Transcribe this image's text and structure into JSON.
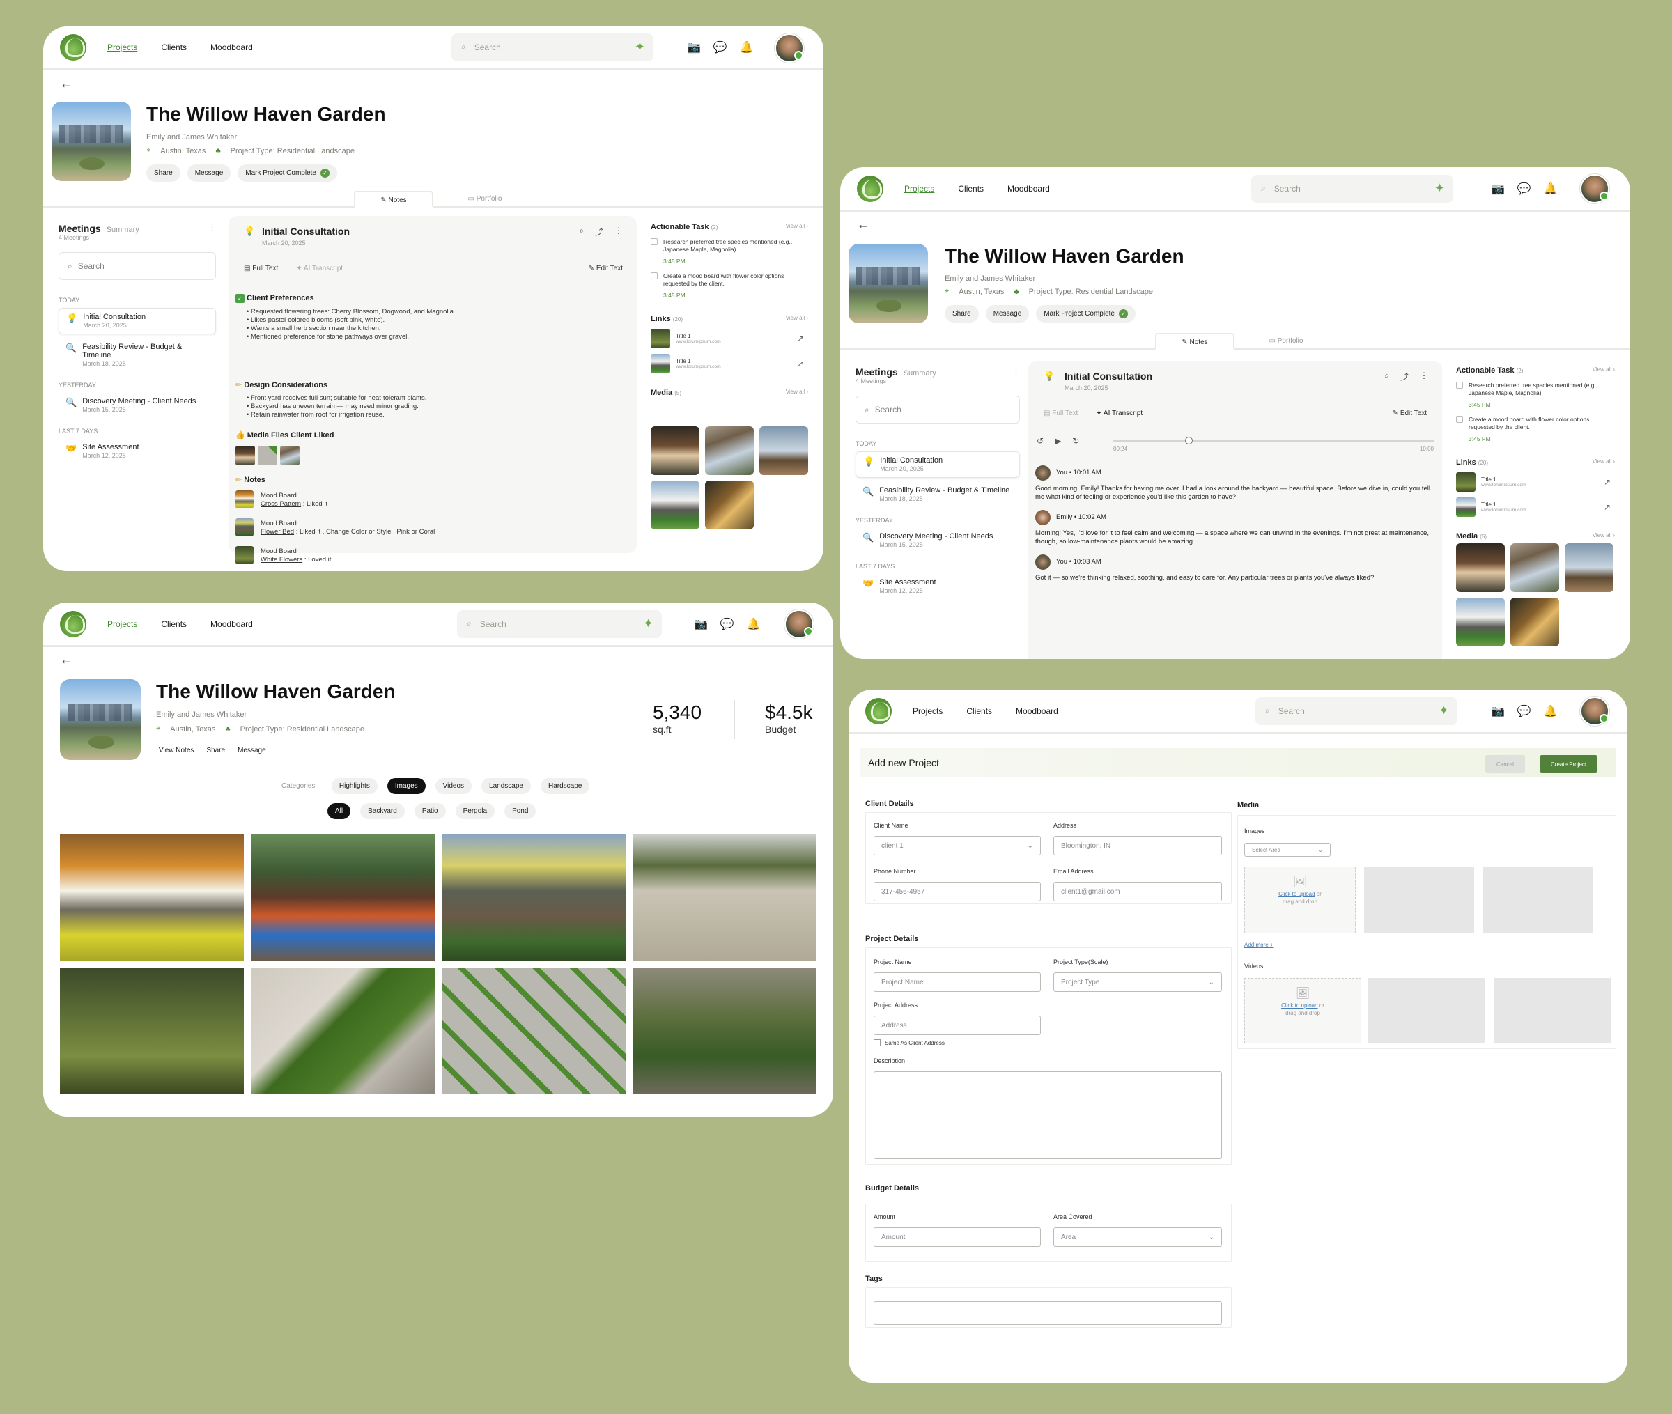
{
  "nav": {
    "projects": "Projects",
    "clients": "Clients",
    "moodboard": "Moodboard",
    "search_placeholder": "Search"
  },
  "project": {
    "title": "The Willow Haven Garden",
    "clients": "Emily and James Whitaker",
    "location": "Austin, Texas",
    "type": "Project Type: Residential Landscape",
    "share": "Share",
    "message": "Message",
    "complete": "Mark Project Complete",
    "view_notes": "View Notes"
  },
  "tabs": {
    "notes": "Notes",
    "portfolio": "Portfolio"
  },
  "meetings": {
    "title": "Meetings",
    "summary": "Summary",
    "count": "4 Meetings",
    "search": "Search",
    "groups": {
      "today": "TODAY",
      "yesterday": "YESTERDAY",
      "last7": "LAST 7 DAYS"
    },
    "items": [
      {
        "name": "Initial Consultation",
        "date": "March 20, 2025"
      },
      {
        "name": "Feasibility Review - Budget & Timeline",
        "date": "March 18, 2025"
      },
      {
        "name": "Discovery Meeting - Client Needs",
        "date": "March 15, 2025"
      },
      {
        "name": "Site Assessment",
        "date": "March 12, 2025"
      }
    ]
  },
  "consult": {
    "title": "Initial Consultation",
    "date": "March 20, 2025",
    "full_text": "Full Text",
    "ai_transcript": "AI Transcript",
    "ai_transcript_faded": "AI Transcript",
    "edit_text": "Edit Text",
    "client_pref": "Client Preferences",
    "pref": [
      "Requested flowering trees: Cherry Blossom, Dogwood, and Magnolia.",
      "Likes pastel-colored blooms (soft pink, white).",
      "Wants a small herb section near the kitchen.",
      "Mentioned preference for stone pathways over gravel."
    ],
    "design": "Design Considerations",
    "design_items": [
      "Front yard receives full sun; suitable for heat-tolerant plants.",
      "Backyard has uneven terrain — may need minor grading.",
      "Retain rainwater from roof for irrigation reuse."
    ],
    "media_liked": "Media Files Client Liked",
    "notes": "Notes",
    "note_items": [
      {
        "title": "Mood Board",
        "link": "Cross Pattern",
        "rest": " : Liked it"
      },
      {
        "title": "Mood Board",
        "link": "Flower Bed",
        "rest": " : Liked it , Change Color or Style , Pink or Coral"
      },
      {
        "title": "Mood Board",
        "link": "White Flowers",
        "rest": " : Loved it"
      }
    ]
  },
  "transcript": {
    "t_start": "00:24",
    "t_end": "10:00",
    "lines": [
      {
        "who": "You • 10:01 AM",
        "text": "Good morning, Emily! Thanks for having me over. I had a look around the backyard — beautiful space. Before we dive in, could you tell me what kind of feeling or experience you'd like this garden to have?"
      },
      {
        "who": "Emily • 10:02 AM",
        "text": "Morning! Yes, I'd love for it to feel calm and welcoming — a space where we can unwind in the evenings. I'm not great at maintenance, though, so low-maintenance plants would be amazing."
      },
      {
        "who": "You • 10:03 AM",
        "text": "Got it — so we're thinking relaxed, soothing, and easy to care for. Any particular trees or plants you've always liked?"
      }
    ]
  },
  "side": {
    "tasks_title": "Actionable Task",
    "tasks_count": "(2)",
    "view_all": "View all",
    "tasks": [
      {
        "text": "Research preferred tree species mentioned (e.g., Japanese Maple, Magnolia).",
        "time": "3:45 PM"
      },
      {
        "text": "Create a mood board with flower color options requested by the client.",
        "time": "3:45 PM"
      }
    ],
    "links_title": "Links",
    "links_count": "(20)",
    "links": [
      {
        "title": "Title 1",
        "url": "www.lorumipsum.com"
      },
      {
        "title": "Title 1",
        "url": "www.lorumipsum.com"
      }
    ],
    "media_title": "Media",
    "media_count": "(5)"
  },
  "portfolio": {
    "area": "5,340",
    "area_unit": "sq.ft",
    "budget": "$4.5k",
    "budget_label": "Budget",
    "categories_label": "Categories :",
    "categories": [
      "Highlights",
      "Images",
      "Videos",
      "Landscape",
      "Hardscape"
    ],
    "filters": [
      "All",
      "Backyard",
      "Patio",
      "Pergola",
      "Pond"
    ]
  },
  "form": {
    "title": "Add new Project",
    "cancel": "Cancel",
    "create": "Create Project",
    "client_details": "Client Details",
    "client_name": "Client Name",
    "client_value": "client 1",
    "address": "Address",
    "address_value": "Bloomington, IN",
    "phone": "Phone Number",
    "phone_value": "317-456-4957",
    "email": "Email Address",
    "email_value": "client1@gmail.com",
    "project_details": "Project Details",
    "project_name": "Project Name",
    "project_name_ph": "Project Name",
    "project_type": "Project Type(Scale)",
    "project_type_ph": "Project Type",
    "project_address": "Project Address",
    "address_ph": "Address",
    "same_as": "Same As Client Address",
    "description": "Description",
    "budget_details": "Budget Details",
    "amount": "Amount",
    "amount_ph": "Amount",
    "area": "Area Covered",
    "area_ph": "Area",
    "tags": "Tags",
    "media": "Media",
    "images": "Images",
    "select_area": "Select Area",
    "click_upload": "Click to upload",
    "or": "or",
    "drag_drop": "drag and drop",
    "add_more": "Add more +",
    "videos": "Videos"
  }
}
